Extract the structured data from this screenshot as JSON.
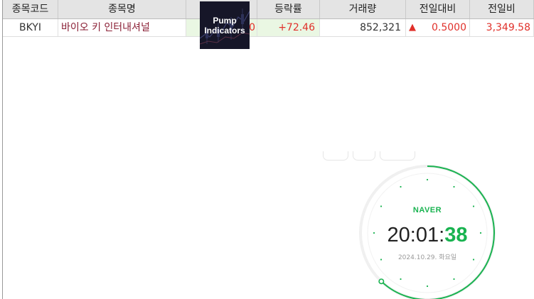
{
  "grid": {
    "columns": [
      "종목코드",
      "종목명",
      "",
      "등락률",
      "거래량",
      "전일대비",
      "전일비"
    ],
    "row": {
      "code": "BKYI",
      "name": "바이오 키 인터내셔널",
      "price_partial": "0",
      "change_rate": "+72.46",
      "volume": "852,321",
      "diff_arrow": "▲",
      "diff": "0.5000",
      "prev_ratio": "3,349.58"
    }
  },
  "overlay": {
    "line1": "Pump",
    "line2": "Indicators"
  },
  "clock": {
    "brand": "NAVER",
    "hour_min": "20:01:",
    "seconds": "38",
    "date": "2024.10.29. 화요일"
  },
  "colors": {
    "up_red": "#e0302a",
    "highlight_green_bg": "#eaf7e3",
    "naver_green": "#19b350",
    "name_color": "#8a1f35",
    "header_bg": "#e4e4e4"
  }
}
